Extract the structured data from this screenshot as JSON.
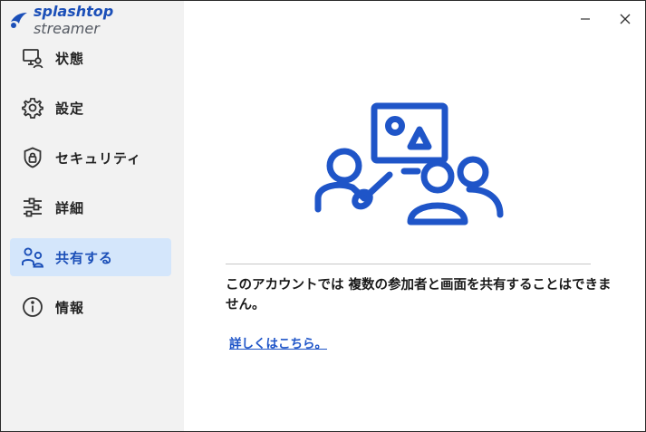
{
  "app": {
    "brand": "splashtop",
    "product": "streamer"
  },
  "sidebar": {
    "items": [
      {
        "label": "状態",
        "icon": "monitor-user-icon",
        "active": false
      },
      {
        "label": "設定",
        "icon": "gear-icon",
        "active": false
      },
      {
        "label": "セキュリティ",
        "icon": "shield-lock-icon",
        "active": false
      },
      {
        "label": "詳細",
        "icon": "sliders-icon",
        "active": false
      },
      {
        "label": "共有する",
        "icon": "users-icon",
        "active": true
      },
      {
        "label": "情報",
        "icon": "info-icon",
        "active": false
      }
    ]
  },
  "window_controls": {
    "minimize_icon": "minimize-icon",
    "close_icon": "close-icon"
  },
  "main": {
    "illustration_icon": "presenter-group-icon",
    "message": "このアカウントでは 複数の参加者と画面を共有することはできません。",
    "link_text": "詳しくはこちら。"
  },
  "colors": {
    "accent": "#1B4FB8",
    "active_bg": "#D4E6FB",
    "sidebar_bg": "#F2F2F2",
    "link": "#1F55C8"
  }
}
